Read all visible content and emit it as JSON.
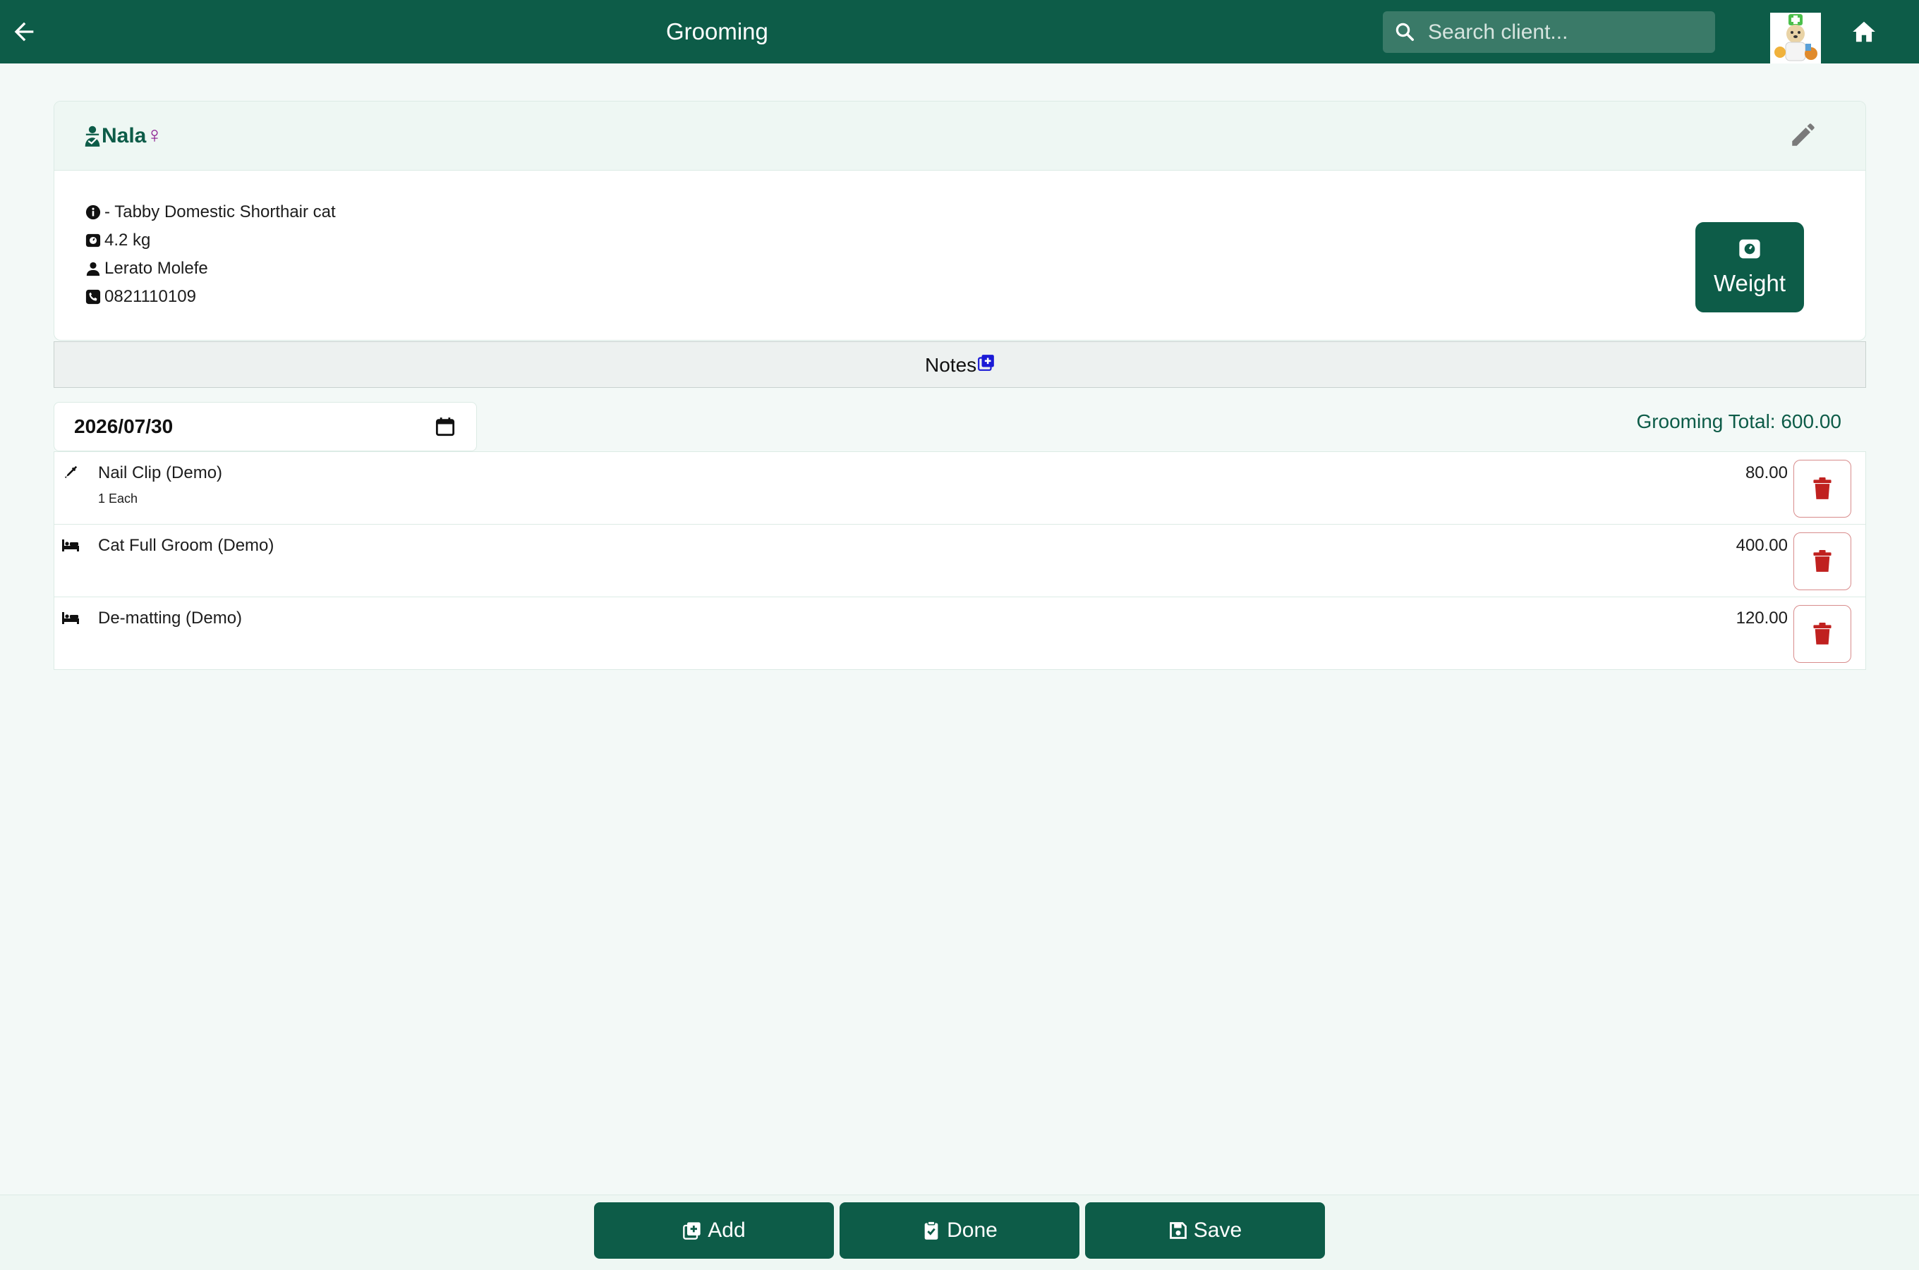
{
  "header": {
    "title": "Grooming",
    "search_placeholder": "Search client..."
  },
  "pet": {
    "name": "Nala",
    "sex_symbol": "♀",
    "breed": "- Tabby Domestic Shorthair cat",
    "weight": "4.2 kg",
    "owner": "Lerato Molefe",
    "phone": "0821110109",
    "weight_button_label": "Weight"
  },
  "notes": {
    "label": "Notes"
  },
  "grooming": {
    "date": "2026/07/30",
    "total": "Grooming Total: 600.00",
    "items": [
      {
        "name": "Nail Clip (Demo)",
        "qty": "1 Each",
        "price": "80.00",
        "icon": "syringe-icon"
      },
      {
        "name": "Cat Full Groom (Demo)",
        "qty": "",
        "price": "400.00",
        "icon": "bed-icon"
      },
      {
        "name": "De-matting (Demo)",
        "qty": "",
        "price": "120.00",
        "icon": "bed-icon"
      }
    ]
  },
  "footer": {
    "add_label": "Add",
    "done_label": "Done",
    "save_label": "Save"
  },
  "colors": {
    "primary": "#0d5c48",
    "danger": "#c0211f",
    "female": "#8a1a8f",
    "notes_add": "#1a1ad6"
  }
}
